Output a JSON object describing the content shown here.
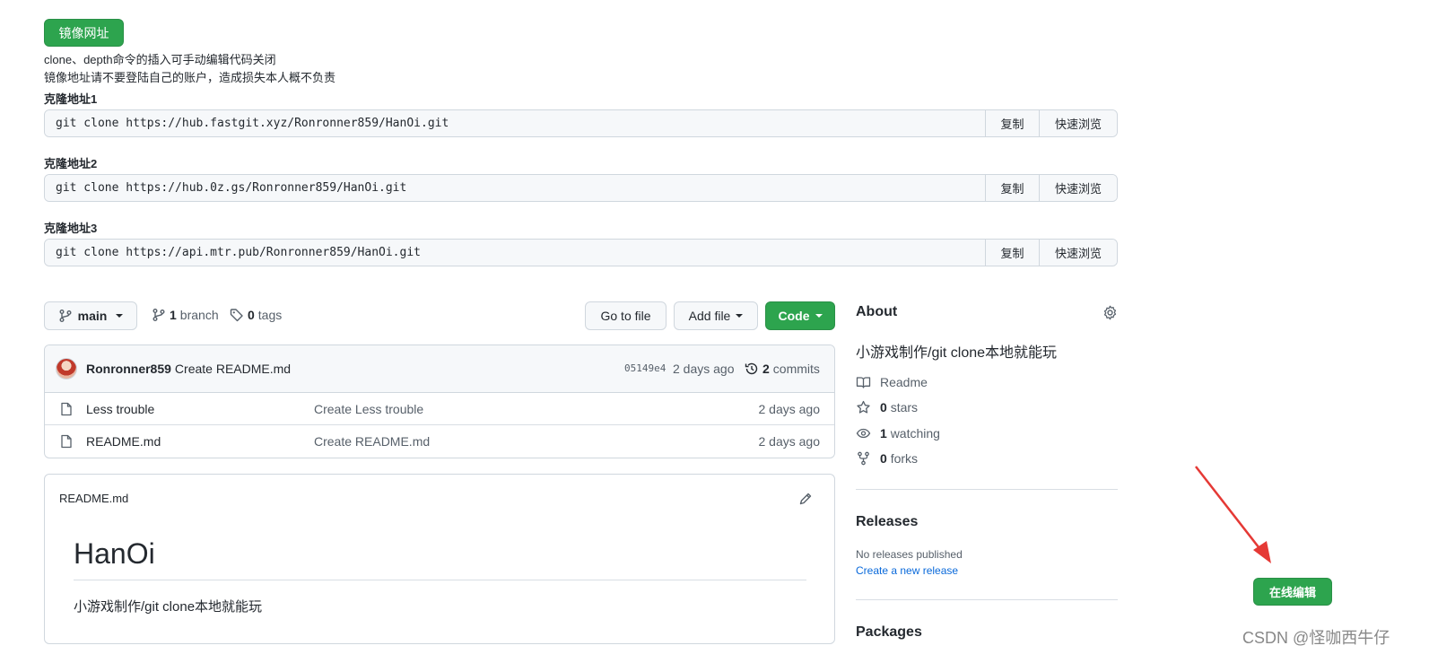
{
  "mirror": {
    "button_label": "镜像网址",
    "note1": "clone、depth命令的插入可手动编辑代码关闭",
    "note2": "镜像地址请不要登陆自己的账户，造成损失本人概不负责",
    "clones": [
      {
        "label": "克隆地址1",
        "command": "git clone https://hub.fastgit.xyz/Ronronner859/HanOi.git",
        "copy": "复制",
        "browse": "快速浏览"
      },
      {
        "label": "克隆地址2",
        "command": "git clone https://hub.0z.gs/Ronronner859/HanOi.git",
        "copy": "复制",
        "browse": "快速浏览"
      },
      {
        "label": "克隆地址3",
        "command": "git clone https://api.mtr.pub/Ronronner859/HanOi.git",
        "copy": "复制",
        "browse": "快速浏览"
      }
    ]
  },
  "repo_bar": {
    "branch": "main",
    "branch_count": "1",
    "branch_label": "branch",
    "tag_count": "0",
    "tag_label": "tags",
    "go_to_file": "Go to file",
    "add_file": "Add file",
    "code": "Code"
  },
  "latest_commit": {
    "author": "Ronronner859",
    "message": "Create README.md",
    "sha": "05149e4",
    "time": "2 days ago",
    "commit_count": "2",
    "commit_label": "commits"
  },
  "files": [
    {
      "name": "Less trouble",
      "message": "Create Less trouble",
      "time": "2 days ago"
    },
    {
      "name": "README.md",
      "message": "Create README.md",
      "time": "2 days ago"
    }
  ],
  "readme": {
    "filename": "README.md",
    "heading": "HanOi",
    "body": "小游戏制作/git clone本地就能玩"
  },
  "about": {
    "title": "About",
    "description": "小游戏制作/git clone本地就能玩",
    "readme": "Readme",
    "stars_count": "0",
    "stars_label": "stars",
    "watching_count": "1",
    "watching_label": "watching",
    "forks_count": "0",
    "forks_label": "forks"
  },
  "releases": {
    "title": "Releases",
    "none": "No releases published",
    "create_link": "Create a new release"
  },
  "packages": {
    "title": "Packages"
  },
  "online_edit": "在线编辑",
  "watermark": "CSDN @怪咖西牛仔",
  "colors": {
    "green": "#2da44e",
    "link": "#0969da",
    "arrow": "#e53935"
  }
}
